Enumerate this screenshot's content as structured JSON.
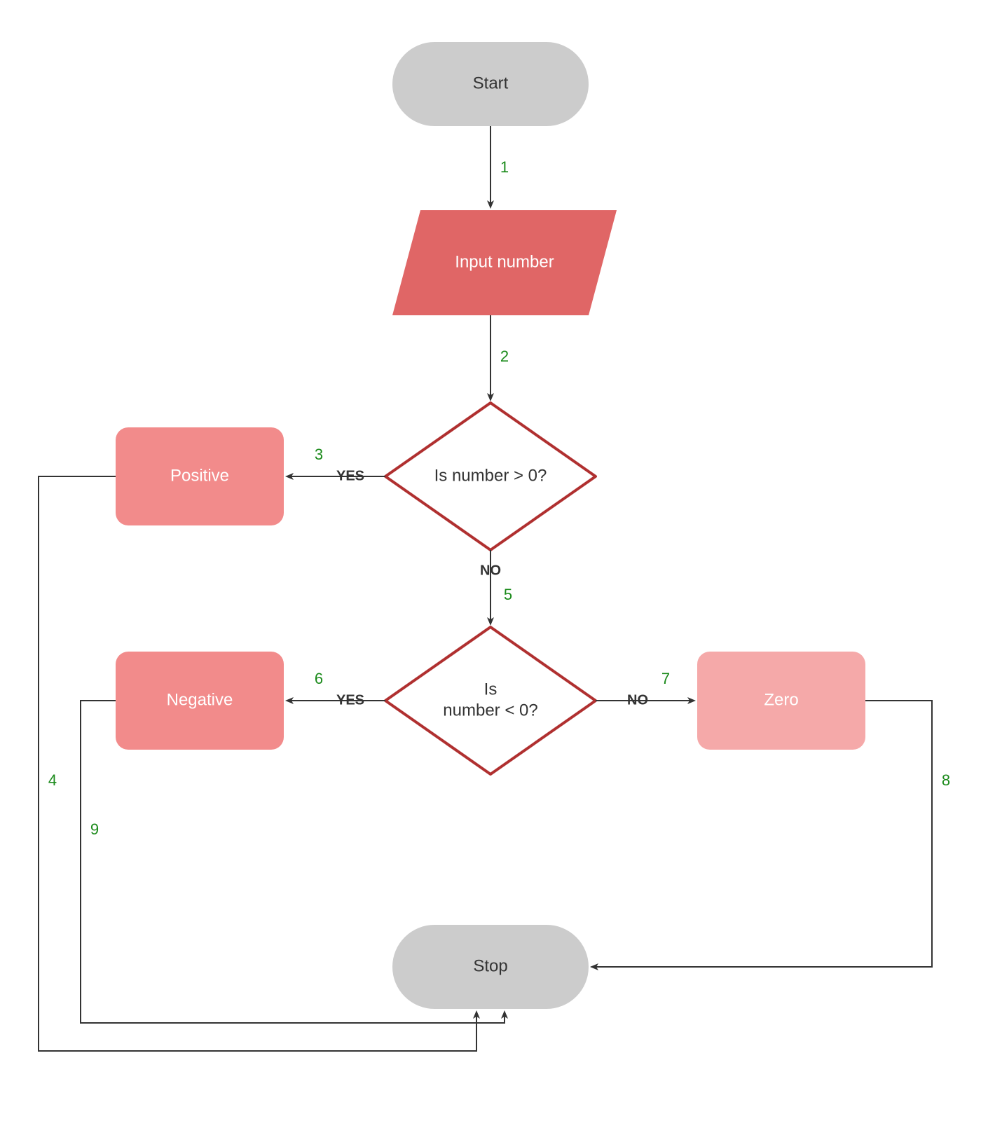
{
  "nodes": {
    "start": {
      "label": "Start"
    },
    "input": {
      "label": "Input number"
    },
    "dec1": {
      "label": "Is number > 0?"
    },
    "dec2a": {
      "label": "Is"
    },
    "dec2b": {
      "label": "number < 0?"
    },
    "pos": {
      "label": "Positive"
    },
    "neg": {
      "label": "Negative"
    },
    "zero": {
      "label": "Zero"
    },
    "stop": {
      "label": "Stop"
    }
  },
  "edges": {
    "e1": {
      "num": "1"
    },
    "e2": {
      "num": "2"
    },
    "e3": {
      "num": "3",
      "word": "YES"
    },
    "e4": {
      "num": "4"
    },
    "e5": {
      "num": "5",
      "word": "NO"
    },
    "e6": {
      "num": "6",
      "word": "YES"
    },
    "e7": {
      "num": "7",
      "word": "NO"
    },
    "e8": {
      "num": "8"
    },
    "e9": {
      "num": "9"
    }
  },
  "colors": {
    "grey": "#cccccc",
    "red_dark": "#e06666",
    "red_mid": "#f28b8b",
    "red_light": "#f5a9a9",
    "diamond_stroke": "#b03030",
    "arrow": "#333333"
  }
}
